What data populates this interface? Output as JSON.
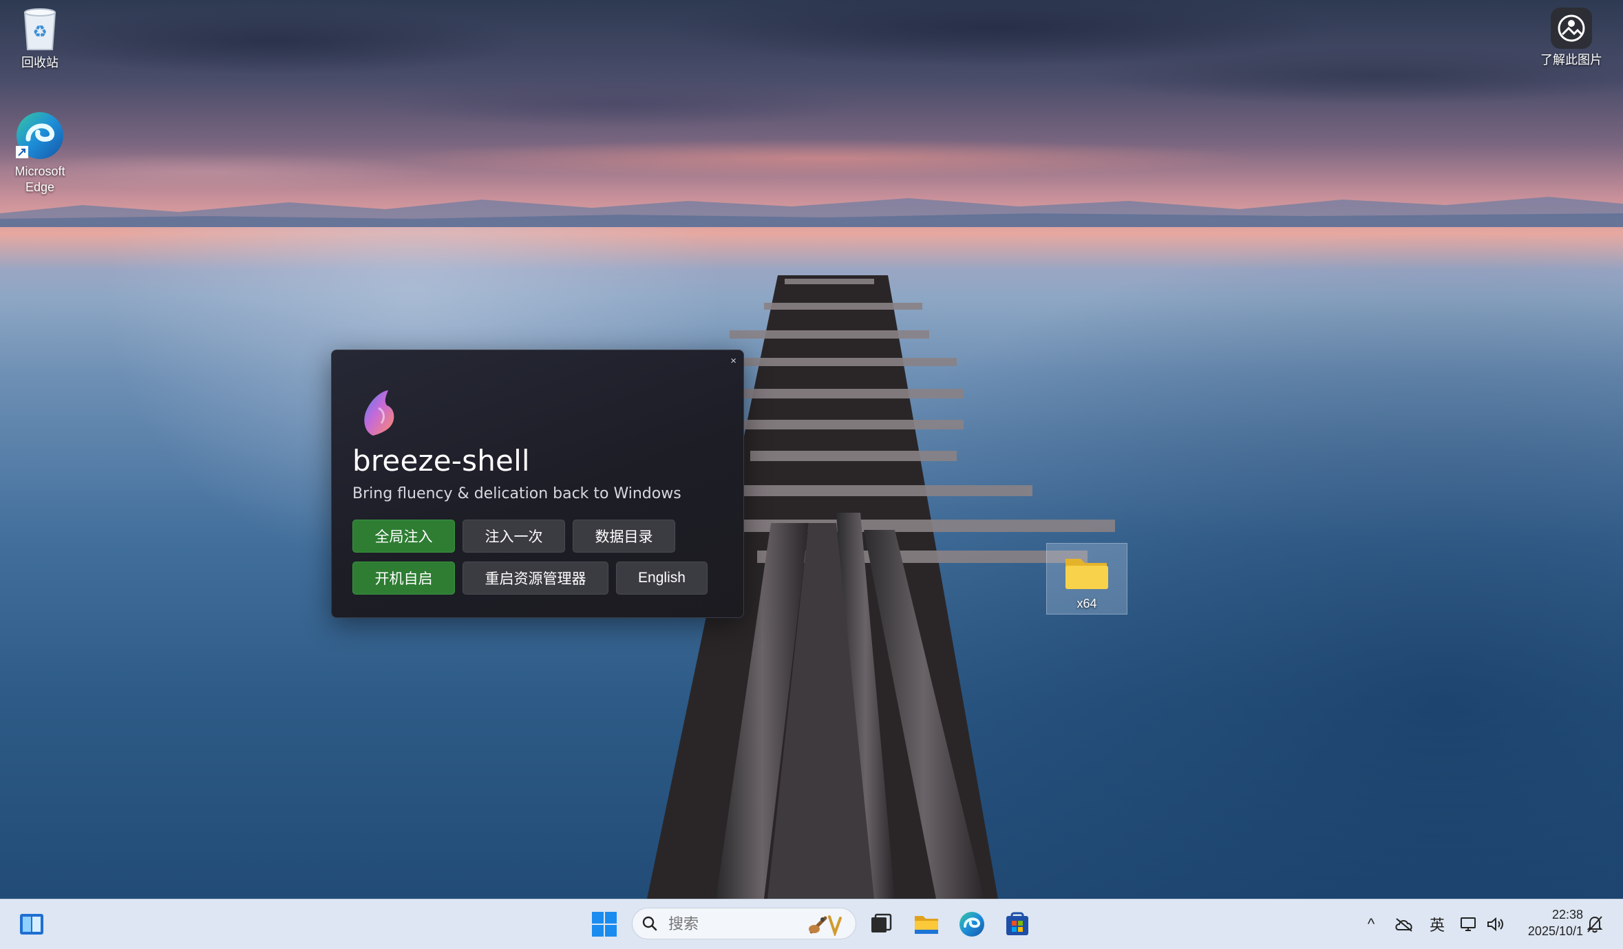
{
  "desktop": {
    "icons": [
      {
        "label": "回收站",
        "icon": "recycle-bin-icon"
      },
      {
        "label": "Microsoft Edge",
        "icon": "edge-icon"
      },
      {
        "label": "了解此图片",
        "icon": "spotlight-icon"
      },
      {
        "label": "x64",
        "icon": "folder-icon"
      }
    ]
  },
  "dialog": {
    "close_label": "×",
    "title": "breeze-shell",
    "subtitle": "Bring fluency & delication back to Windows",
    "buttons": {
      "global_inject": "全局注入",
      "inject_once": "注入一次",
      "data_dir": "数据目录",
      "autostart": "开机自启",
      "restart_explorer": "重启资源管理器",
      "language": "English"
    },
    "colors": {
      "active": "#2e7d33",
      "inactive": "#3b3b42"
    }
  },
  "taskbar": {
    "search_placeholder": "搜索",
    "apps": [
      "task-view-icon",
      "file-explorer-icon",
      "edge-icon",
      "store-icon"
    ],
    "tray": {
      "chevron": "^",
      "ime": "英",
      "time": "22:38",
      "date": "2025/10/1"
    }
  }
}
